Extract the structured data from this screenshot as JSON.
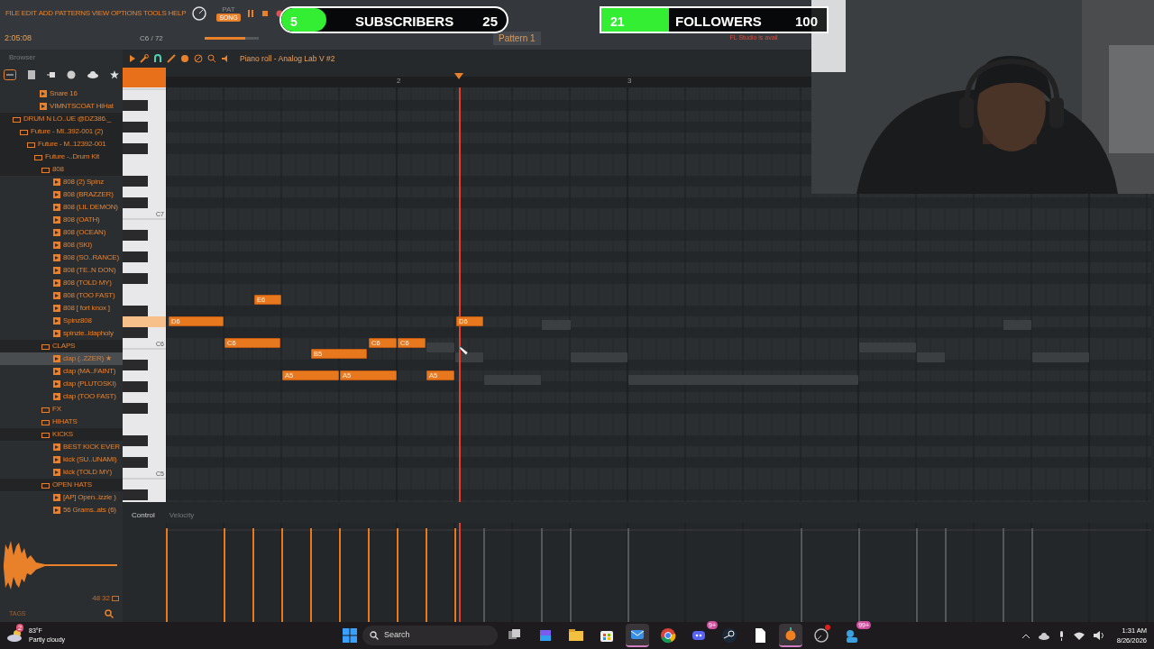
{
  "menu": [
    "FILE",
    "EDIT",
    "ADD",
    "PATTERNS",
    "VIEW",
    "OPTIONS",
    "TOOLS",
    "HELP"
  ],
  "transport": {
    "pat_label": "PAT",
    "mode": "SONG"
  },
  "info": {
    "time": "2:05:08",
    "note": "C6 / 72"
  },
  "volume": {
    "level": 0.75
  },
  "pattern": "Pattern 1",
  "news": "FL Studio is avail",
  "browser": {
    "title": "Browser",
    "items": [
      {
        "kind": "file",
        "label": "Snare 16",
        "selected": false
      },
      {
        "kind": "file",
        "label": "VIMNTSCOAT HiHat",
        "selected": false
      },
      {
        "kind": "folder",
        "label": "DRUM N LO..UE @DZ386._",
        "selected": false,
        "children": [
          {
            "kind": "folder",
            "label": "Future - MI..392-001 (2)",
            "selected": false,
            "children": [
              {
                "kind": "folder",
                "label": "Future - M..12392-001",
                "selected": false,
                "children": [
                  {
                    "kind": "folder",
                    "label": "Future -..Drum Kit",
                    "selected": false,
                    "children": [
                      {
                        "kind": "folder",
                        "label": "808",
                        "selected": false,
                        "children": [
                          {
                            "kind": "file",
                            "label": "808 (2) Spinz",
                            "selected": false
                          },
                          {
                            "kind": "file",
                            "label": "808 (BRAZZER)",
                            "selected": false
                          },
                          {
                            "kind": "file",
                            "label": "808 (LIL DEMON)",
                            "selected": false
                          },
                          {
                            "kind": "file",
                            "label": "808 (OATH)",
                            "selected": false
                          },
                          {
                            "kind": "file",
                            "label": "808 (OCEAN)",
                            "selected": false
                          },
                          {
                            "kind": "file",
                            "label": "808 (SKI)",
                            "selected": false
                          },
                          {
                            "kind": "file",
                            "label": "808 (SO..RANCE)",
                            "selected": false
                          },
                          {
                            "kind": "file",
                            "label": "808 (TE..N DON)",
                            "selected": false
                          },
                          {
                            "kind": "file",
                            "label": "808 (TOLD MY)",
                            "selected": false
                          },
                          {
                            "kind": "file",
                            "label": "808 (TOO FAST)",
                            "selected": false
                          },
                          {
                            "kind": "file",
                            "label": "808 [ fort knox ]",
                            "selected": false
                          },
                          {
                            "kind": "file",
                            "label": "Spinz808",
                            "selected": false
                          },
                          {
                            "kind": "file",
                            "label": "spinzie..ldapholy",
                            "selected": false
                          }
                        ]
                      },
                      {
                        "kind": "folder",
                        "label": "CLAPS",
                        "selected": false,
                        "children": [
                          {
                            "kind": "file",
                            "label": "clap (..ZZER) ★",
                            "selected": true
                          },
                          {
                            "kind": "file",
                            "label": "clap (MA..FAINT)",
                            "selected": false
                          },
                          {
                            "kind": "file",
                            "label": "clap (PLUTOSKI)",
                            "selected": false
                          },
                          {
                            "kind": "file",
                            "label": "clap (TOO FAST)",
                            "selected": false
                          }
                        ]
                      },
                      {
                        "kind": "folder",
                        "label": "FX",
                        "selected": false
                      },
                      {
                        "kind": "folder",
                        "label": "HIHATS",
                        "selected": false
                      },
                      {
                        "kind": "folder",
                        "label": "KICKS",
                        "selected": false,
                        "children": [
                          {
                            "kind": "file",
                            "label": "BEST KICK EVER",
                            "selected": false
                          },
                          {
                            "kind": "file",
                            "label": "kick (SU..UNAMI)",
                            "selected": false
                          },
                          {
                            "kind": "file",
                            "label": "kick (TOLD MY)",
                            "selected": false
                          }
                        ]
                      },
                      {
                        "kind": "folder",
                        "label": "OPEN HATS",
                        "selected": false,
                        "children": [
                          {
                            "kind": "file",
                            "label": "[AP] Open..izzle )",
                            "selected": false
                          },
                          {
                            "kind": "file",
                            "label": "56 Grams..ats (6)",
                            "selected": false
                          }
                        ]
                      }
                    ]
                  }
                ]
              }
            ]
          }
        ]
      }
    ],
    "sample": {
      "rate": "48",
      "bits": "32"
    },
    "tags": "TAGS"
  },
  "piano_roll": {
    "title": "Piano roll - Analog Lab V #2",
    "ruler": [
      "2",
      "3"
    ],
    "key_labels": [
      "C7",
      "C6",
      "C5"
    ],
    "notes": [
      {
        "label": "E6"
      },
      {
        "label": "D6"
      },
      {
        "label": "D6"
      },
      {
        "label": "C6"
      },
      {
        "label": "C6"
      },
      {
        "label": "C6"
      },
      {
        "label": "B5"
      },
      {
        "label": "A5"
      },
      {
        "label": "A5"
      },
      {
        "label": "A5"
      }
    ],
    "control": "Control",
    "control_target": "Velocity"
  },
  "overlays": [
    {
      "kind": "pill",
      "count": "5",
      "label": "SUBSCRIBERS",
      "goal": "25",
      "level": 0.2
    },
    {
      "kind": "box",
      "count": "21",
      "label": "FOLLOWERS",
      "goal": "100",
      "level": 0.3
    }
  ],
  "taskbar": {
    "weather": {
      "temp": "83°F",
      "condition": "Partly cloudy",
      "badge": "2"
    },
    "search": "Search",
    "apps": [
      {
        "kind": "taskview",
        "selected": false
      },
      {
        "kind": "suite",
        "selected": false
      },
      {
        "kind": "folder",
        "selected": false
      },
      {
        "kind": "store",
        "selected": false
      },
      {
        "kind": "mail",
        "selected": true
      },
      {
        "kind": "chrome",
        "selected": false
      },
      {
        "kind": "chat",
        "selected": false,
        "badge": "9+"
      },
      {
        "kind": "steam",
        "selected": false
      },
      {
        "kind": "file",
        "selected": false
      },
      {
        "kind": "fruit",
        "selected": true
      },
      {
        "kind": "ring",
        "selected": false,
        "dot": true
      },
      {
        "kind": "people",
        "selected": false,
        "badge": "99+"
      }
    ],
    "time": "1:31 AM",
    "date": "8/26/2026"
  }
}
